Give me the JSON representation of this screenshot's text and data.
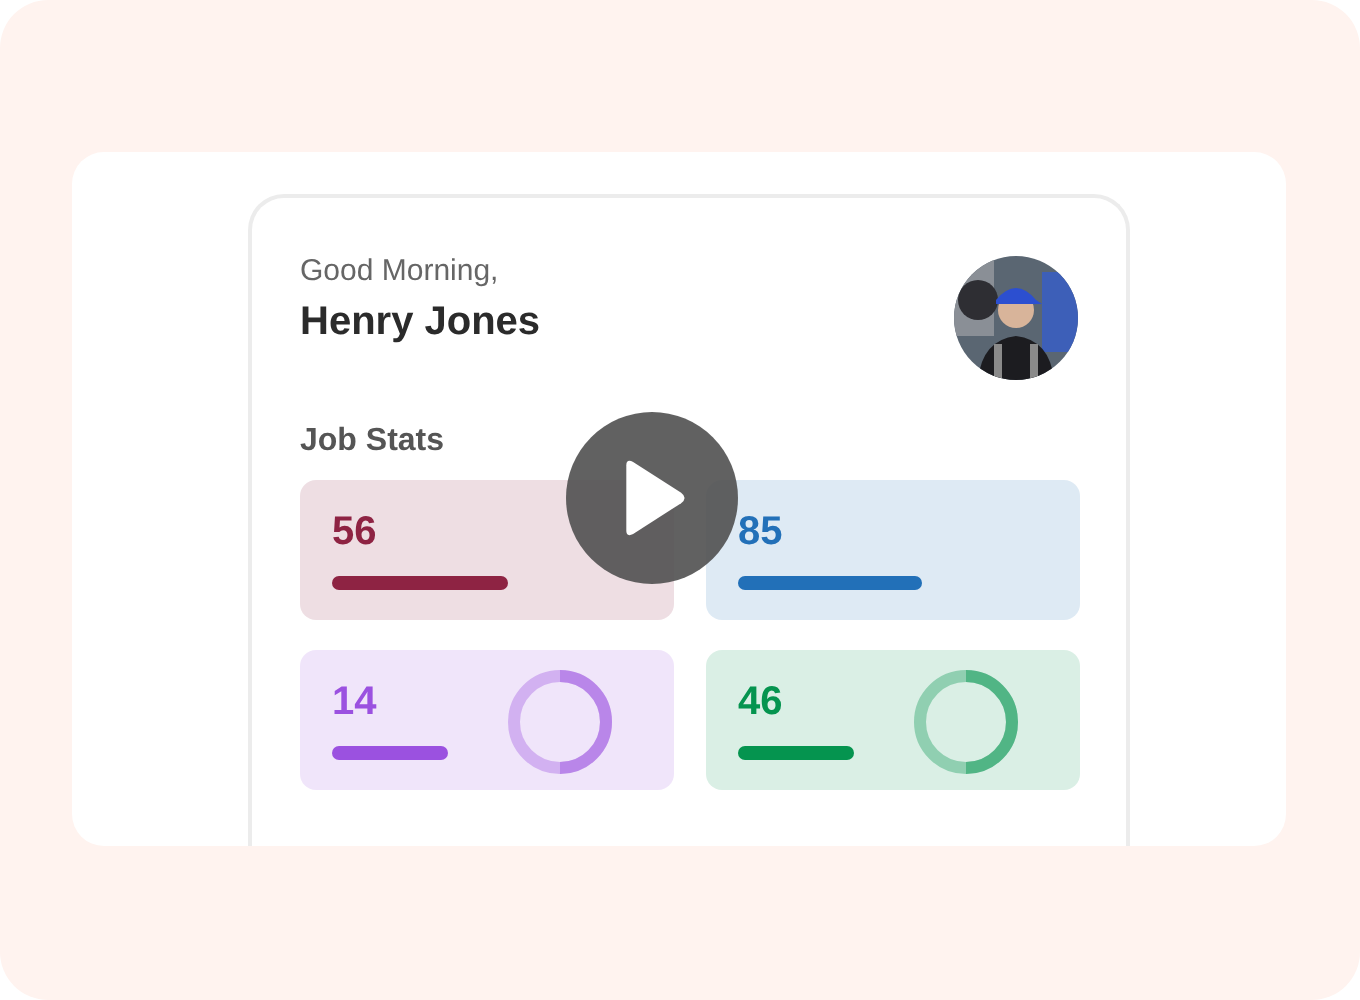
{
  "greeting": "Good Morning,",
  "user_name": "Henry Jones",
  "section_title": "Job Stats",
  "stats": [
    {
      "value": "56",
      "color": "#8e2343",
      "kind": "plain"
    },
    {
      "value": "85",
      "color": "#2270b8",
      "kind": "plain"
    },
    {
      "value": "14",
      "color": "#9b51e0",
      "kind": "ring"
    },
    {
      "value": "46",
      "color": "#05944f",
      "kind": "ring"
    }
  ],
  "video": {
    "kind": "play"
  }
}
